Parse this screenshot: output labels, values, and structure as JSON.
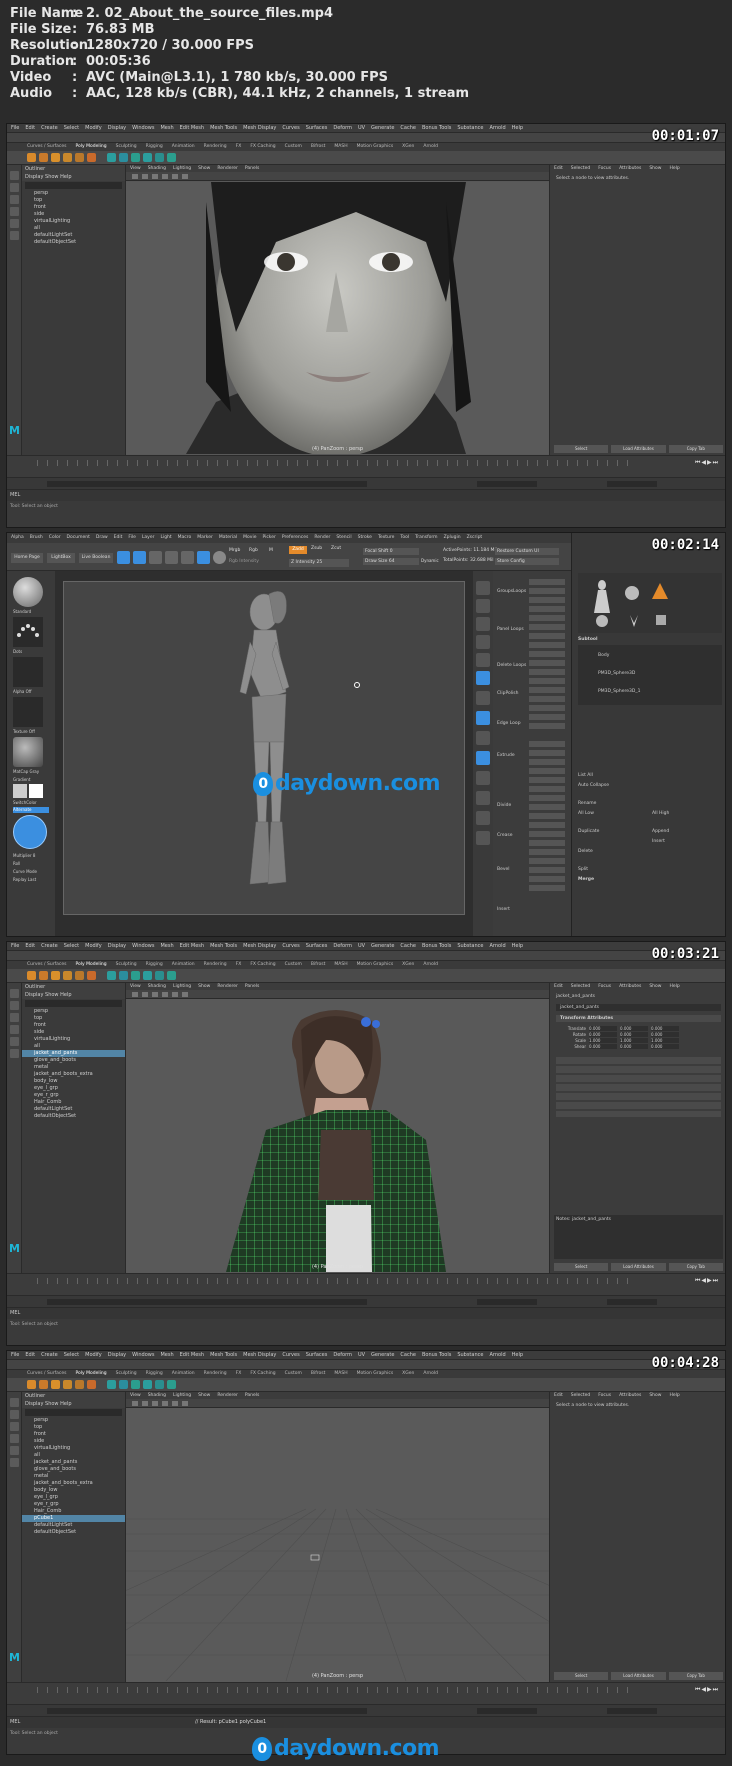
{
  "file_info": [
    {
      "label": "File Name",
      "value": "2. 02_About_the_source_files.mp4"
    },
    {
      "label": "File Size",
      "value": "76.83 MB"
    },
    {
      "label": "Resolution",
      "value": "1280x720 / 30.000 FPS"
    },
    {
      "label": "Duration",
      "value": "00:05:36"
    },
    {
      "label": "Video",
      "value": "AVC (Main@L3.1), 1 780 kb/s, 30.000 FPS"
    },
    {
      "label": "Audio",
      "value": "AAC, 128 kb/s (CBR), 44.1 kHz, 2 channels, 1 stream"
    }
  ],
  "separator": ":",
  "frames": [
    {
      "timestamp": "00:01:07"
    },
    {
      "timestamp": "00:02:14"
    },
    {
      "timestamp": "00:03:21"
    },
    {
      "timestamp": "00:04:28"
    }
  ],
  "maya": {
    "menus": [
      "File",
      "Edit",
      "Create",
      "Select",
      "Modify",
      "Display",
      "Windows",
      "Mesh",
      "Edit Mesh",
      "Mesh Tools",
      "Mesh Display",
      "Curves",
      "Surfaces",
      "Deform",
      "UV",
      "Generate",
      "Cache",
      "Bonus Tools",
      "Substance",
      "Arnold",
      "Help"
    ],
    "shelf_tabs": [
      "Curves / Surfaces",
      "Poly Modeling",
      "Sculpting",
      "Rigging",
      "Animation",
      "Rendering",
      "FX",
      "FX Caching",
      "Custom",
      "Bifrost",
      "MASH",
      "Motion Graphics",
      "XGen",
      "Arnold"
    ],
    "view_menus": [
      "View",
      "Shading",
      "Lighting",
      "Show",
      "Renderer",
      "Panels"
    ],
    "outliner_title": "Outliner",
    "outliner_menus": "Display  Show  Help",
    "attr_tabs": [
      "Edit",
      "Selected",
      "Focus",
      "Attributes",
      "Show",
      "Help"
    ],
    "attr_empty_msg": "Select a node to view attributes.",
    "attr_buttons": [
      "Select",
      "Load Attributes",
      "Copy Tab"
    ],
    "camera_label": "(4) PanZoom : persp",
    "mel_label": "MEL",
    "help_text": "Tool: Select an object",
    "frame1_outliner": [
      "persp",
      "top",
      "front",
      "side",
      "virtualLighting",
      "all",
      "defaultLightSet",
      "defaultObjectSet"
    ],
    "frame3_outliner": [
      "persp",
      "top",
      "front",
      "side",
      "virtualLighting",
      "all",
      "jacket_and_pants",
      "glove_and_boots",
      "metal",
      "jacket_and_boots_extra",
      "body_low",
      "eye_l_grp",
      "eye_r_grp",
      "Hair_Comb",
      "defaultLightSet",
      "defaultObjectSet"
    ],
    "frame3_selected": "jacket_and_pants",
    "frame3_attr_node": "jacket_and_pants",
    "frame3_attr_section": "Transform Attributes",
    "frame3_attr_rows": [
      {
        "name": "Translate",
        "v": [
          "0.000",
          "0.000",
          "0.000"
        ]
      },
      {
        "name": "Rotate",
        "v": [
          "0.000",
          "0.000",
          "0.000"
        ]
      },
      {
        "name": "Scale",
        "v": [
          "1.000",
          "1.000",
          "1.000"
        ]
      },
      {
        "name": "Shear",
        "v": [
          "0.000",
          "0.000",
          "0.000"
        ]
      }
    ],
    "frame3_notes": "Notes: jacket_and_pants",
    "frame4_outliner": [
      "persp",
      "top",
      "front",
      "side",
      "virtualLighting",
      "all",
      "jacket_and_pants",
      "glove_and_boots",
      "metal",
      "jacket_and_boots_extra",
      "body_low",
      "eye_l_grp",
      "eye_r_grp",
      "Hair_Comb",
      "pCube1",
      "defaultLightSet",
      "defaultObjectSet"
    ],
    "frame4_selected": "pCube1",
    "frame4_cmd": "// Result: pCube1 polyCube1"
  },
  "zbrush": {
    "menus": [
      "Alpha",
      "Brush",
      "Color",
      "Document",
      "Draw",
      "Edit",
      "File",
      "Layer",
      "Light",
      "Macro",
      "Marker",
      "Material",
      "Movie",
      "Picker",
      "Preferences",
      "Render",
      "Stencil",
      "Stroke",
      "Texture",
      "Tool",
      "Transform",
      "Zplugin",
      "Zscript"
    ],
    "home_page": "Home Page",
    "lightbox": "LightBox",
    "live_boolean": "Live Boolean",
    "mrgb": "Mrgb",
    "rgb": "Rgb",
    "m": "M",
    "zadd": "Zadd",
    "zsub": "Zsub",
    "zcut": "Zcut",
    "rgb_intensity": "Rgb Intensity",
    "z_intensity": "Z Intensity 25",
    "focal_shift": "Focal Shift 0",
    "draw_size": "Draw Size 64",
    "dynamic": "Dynamic",
    "active_points": "ActivePoints: 11.184 Mil",
    "total_points": "TotalPoints: 32.688 Mil",
    "left_labels": [
      "Standard",
      "Dots",
      "Alpha Off",
      "Texture Off",
      "MatCap Gray",
      "Gradient",
      "SwitchColor",
      "Alternate",
      "Multiplier 8",
      "Roll",
      "Curve Mode",
      "Replay Last"
    ],
    "subtool": "Subtool",
    "subtool_items": [
      "Body",
      "PM3D_Sphere3D",
      "PM3D_Sphere3D_1"
    ],
    "right_labels": [
      "Restore Custom UI",
      "Store Config"
    ],
    "panel_labels": [
      "GroupsLoops",
      "Panel Loops",
      "Delete Loops",
      "ClipPolish",
      "Edge Loop",
      "Extrude",
      "Divide",
      "Crease",
      "Bevel",
      "Insert"
    ],
    "right_panel_labels": [
      "Merge",
      "Append",
      "Insert",
      "Delete",
      "Split",
      "Duplicate",
      "List All",
      "Auto Collapse",
      "Rename",
      "All Low",
      "All High"
    ]
  },
  "watermark_text": "daydown.com",
  "watermark_glyph": "0"
}
